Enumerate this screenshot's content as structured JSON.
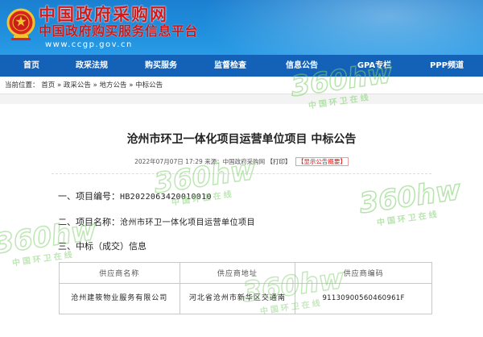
{
  "header": {
    "site_title": "中国政府采购网",
    "site_subtitle": "中国政府购买服务信息平台",
    "site_url": "www.ccgp.gov.cn"
  },
  "nav": {
    "items": [
      {
        "label": "首页"
      },
      {
        "label": "政采法规"
      },
      {
        "label": "购买服务"
      },
      {
        "label": "监督检查"
      },
      {
        "label": "信息公告"
      },
      {
        "label": "GPA专栏"
      },
      {
        "label": "PPP频道"
      }
    ]
  },
  "breadcrumb": {
    "prefix": "当前位置：",
    "items": [
      "首页",
      "政采公告",
      "地方公告",
      "中标公告"
    ],
    "separator": "»"
  },
  "article": {
    "title": "沧州市环卫一体化项目运营单位项目 中标公告",
    "meta_text": "2022年07月07日 17:29 来源：中国政府采购网 ",
    "print_label": "【打印】",
    "summary_label": "【显示公告概要】",
    "item1_label": "一、项目编号：",
    "item1_value": "HB2022063420010010",
    "item2_label": "二、项目名称：",
    "item2_value": "沧州市环卫一体化项目运营单位项目",
    "item3_label": "三、中标（成交）信息"
  },
  "table": {
    "headers": [
      "供应商名称",
      "供应商地址",
      "供应商编码"
    ],
    "rows": [
      [
        "沧州建筱物业服务有限公司",
        "河北省沧州市新华区交通南",
        "91130900560460961F"
      ]
    ]
  },
  "watermark": {
    "text": "360hw",
    "subtext": "中国环卫在线",
    "color": "#7ccf6a"
  },
  "colors": {
    "header_blue": "#1f8fdd",
    "nav_blue": "#1462b8",
    "logo_red": "#d21a1a"
  }
}
